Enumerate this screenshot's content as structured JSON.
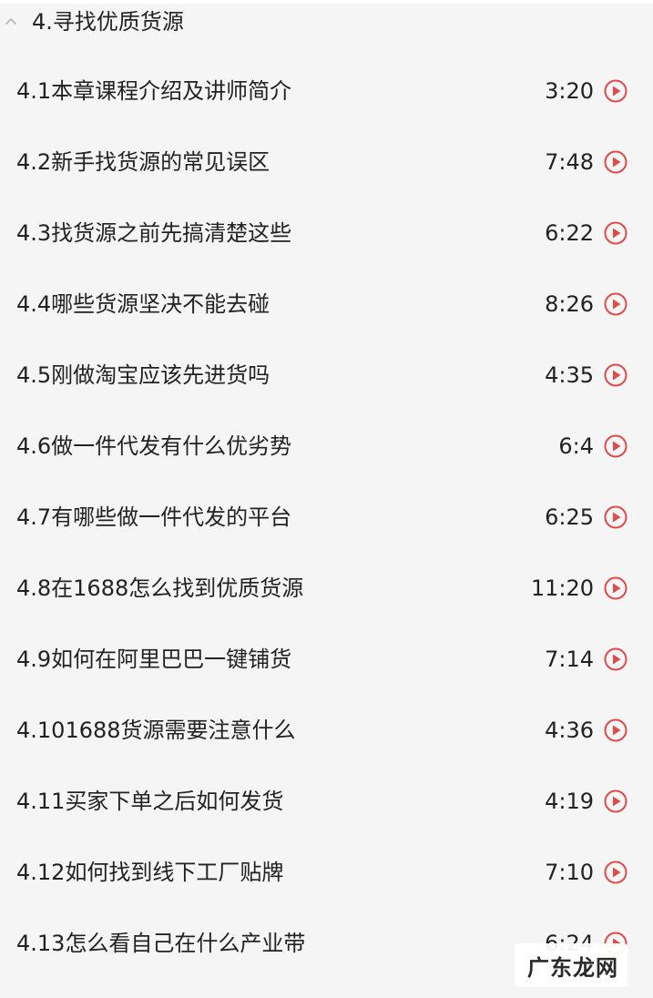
{
  "section": {
    "title": "4.寻找优质货源"
  },
  "colors": {
    "accent": "#e04b4b",
    "text": "#222222",
    "background": "#f5f5f5"
  },
  "icons": {
    "collapse": "chevron-up-icon",
    "play": "play-circle-icon"
  },
  "lessons": [
    {
      "title": "4.1本章课程介绍及讲师简介",
      "duration": "3:20"
    },
    {
      "title": "4.2新手找货源的常见误区",
      "duration": "7:48"
    },
    {
      "title": "4.3找货源之前先搞清楚这些",
      "duration": "6:22"
    },
    {
      "title": "4.4哪些货源坚决不能去碰",
      "duration": "8:26"
    },
    {
      "title": "4.5刚做淘宝应该先进货吗",
      "duration": "4:35"
    },
    {
      "title": "4.6做一件代发有什么优劣势",
      "duration": "6:4"
    },
    {
      "title": "4.7有哪些做一件代发的平台",
      "duration": "6:25"
    },
    {
      "title": "4.8在1688怎么找到优质货源",
      "duration": "11:20"
    },
    {
      "title": "4.9如何在阿里巴巴一键铺货",
      "duration": "7:14"
    },
    {
      "title": "4.101688货源需要注意什么",
      "duration": "4:36"
    },
    {
      "title": "4.11买家下单之后如何发货",
      "duration": "4:19"
    },
    {
      "title": "4.12如何找到线下工厂贴牌",
      "duration": "7:10"
    },
    {
      "title": "4.13怎么看自己在什么产业带",
      "duration": "6:24"
    }
  ],
  "watermark": {
    "text": "广东龙网"
  }
}
